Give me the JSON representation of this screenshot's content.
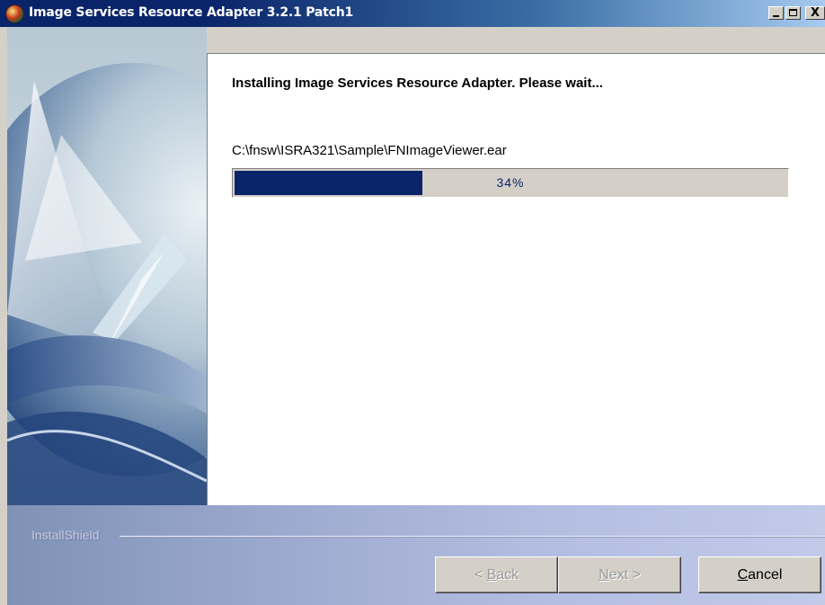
{
  "window": {
    "title": "Image Services Resource Adapter 3.2.1 Patch1",
    "controls": {
      "minimize_icon": "minimize-icon",
      "maximize_icon": "maximize-icon",
      "close_label": "X"
    }
  },
  "content": {
    "heading": "Installing Image Services Resource Adapter. Please wait...",
    "current_file": "C:\\fnsw\\ISRA321\\Sample\\FNImageViewer.ear",
    "progress": {
      "percent": 34,
      "label": "34%",
      "fill_color": "#0a246a"
    }
  },
  "branding": {
    "label": "InstallShield"
  },
  "buttons": {
    "back": {
      "prefix": "< ",
      "mnemonic": "B",
      "rest": "ack",
      "enabled": false
    },
    "next": {
      "mnemonic": "N",
      "rest": "ext >",
      "enabled": false
    },
    "cancel": {
      "mnemonic": "C",
      "rest": "ancel",
      "enabled": true
    }
  }
}
